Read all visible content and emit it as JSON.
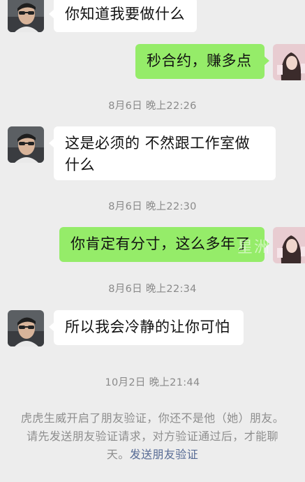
{
  "messages": [
    {
      "side": "in",
      "text": "你知道我要做什么"
    },
    {
      "side": "out",
      "text": "秒合约，赚多点"
    },
    {
      "side": "in",
      "text": "这是必须的 不然跟工作室做什么"
    },
    {
      "side": "out",
      "text": "你肯定有分寸，这么多年了"
    },
    {
      "side": "in",
      "text": "所以我会冷静的让你可怕"
    }
  ],
  "timestamps": [
    "8月6日 晚上22:26",
    "8月6日 晚上22:30",
    "8月6日 晚上22:34",
    "10月2日 晚上21:44"
  ],
  "system_notice": {
    "text": "虎虎生威开启了朋友验证，你还不是他（她）朋友。请先发送朋友验证请求，对方验证通过后，才能聊天。",
    "link": "发送朋友验证"
  },
  "watermark": "星洲",
  "colors": {
    "background": "#ededed",
    "incoming_bubble": "#ffffff",
    "outgoing_bubble": "#95ec69",
    "link": "#576b95"
  }
}
